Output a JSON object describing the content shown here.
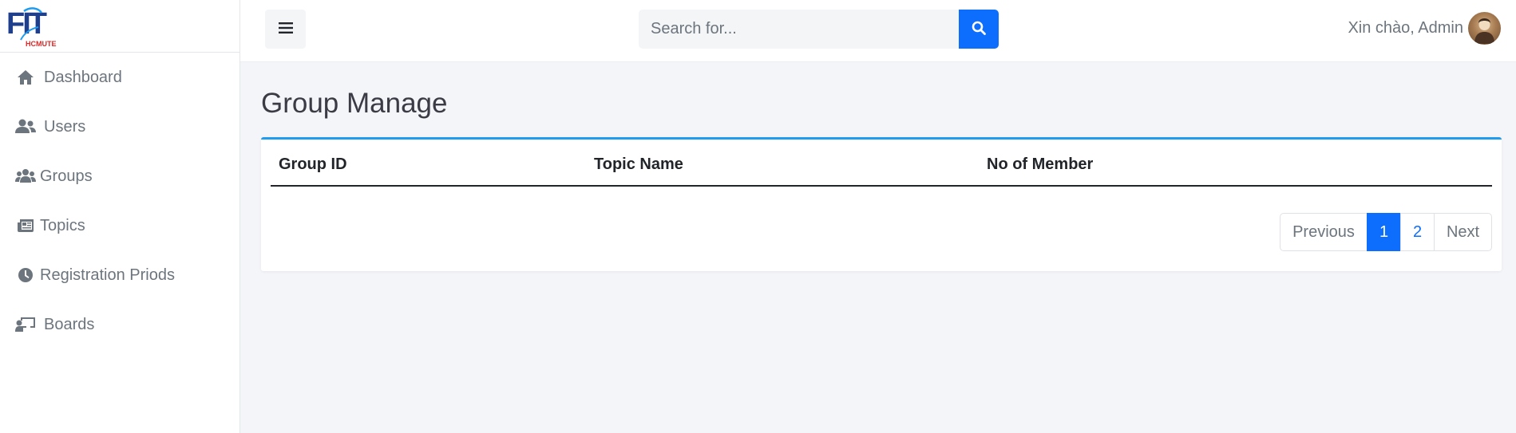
{
  "brand": {
    "logo_text": "FIT",
    "logo_sub": "HCMUTE"
  },
  "sidebar": {
    "items": [
      {
        "label": "Dashboard",
        "icon": "home-icon"
      },
      {
        "label": "Users",
        "icon": "users-icon"
      },
      {
        "label": "Groups",
        "icon": "groups-icon"
      },
      {
        "label": "Topics",
        "icon": "newspaper-icon"
      },
      {
        "label": "Registration Priods",
        "icon": "clock-icon"
      },
      {
        "label": "Boards",
        "icon": "chalkboard-user-icon"
      }
    ]
  },
  "topbar": {
    "toggle_icon": "hamburger-icon",
    "search": {
      "placeholder": "Search for...",
      "value": ""
    },
    "greeting": "Xin chào, Admin"
  },
  "page": {
    "title": "Group Manage",
    "table": {
      "headers": [
        "Group ID",
        "Topic Name",
        "No of Member"
      ],
      "rows": []
    },
    "pagination": {
      "prev": "Previous",
      "pages": [
        "1",
        "2"
      ],
      "active": "1",
      "next": "Next"
    }
  },
  "colors": {
    "accent": "#0d6efd",
    "card_border": "#1e9cf0",
    "brand_blue": "#1f3e8c",
    "brand_red": "#d42a2a"
  }
}
